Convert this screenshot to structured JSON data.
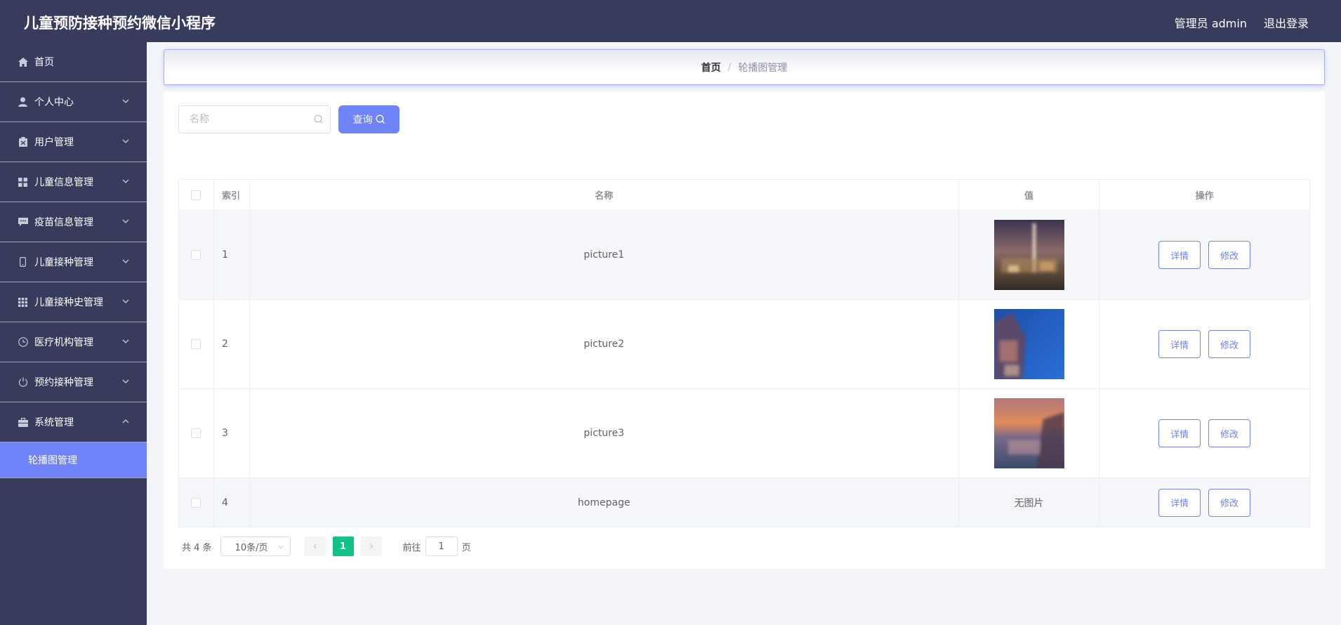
{
  "header": {
    "app_title": "儿童预防接种预约微信小程序",
    "admin_label": "管理员 admin",
    "logout_label": "退出登录"
  },
  "sidebar": {
    "items": [
      {
        "label": "首页",
        "icon": "home-icon"
      },
      {
        "label": "个人中心",
        "icon": "user-icon"
      },
      {
        "label": "用户管理",
        "icon": "clipboard-icon"
      },
      {
        "label": "儿童信息管理",
        "icon": "grid-icon"
      },
      {
        "label": "疫苗信息管理",
        "icon": "chat-icon"
      },
      {
        "label": "儿童接种管理",
        "icon": "phone-icon"
      },
      {
        "label": "儿童接种史管理",
        "icon": "apps-icon"
      },
      {
        "label": "医疗机构管理",
        "icon": "clock-icon"
      },
      {
        "label": "预约接种管理",
        "icon": "power-icon"
      },
      {
        "label": "系统管理",
        "icon": "briefcase-icon"
      }
    ],
    "submenu_active": "轮播图管理",
    "active_color": "#6e84f8"
  },
  "breadcrumb": {
    "home": "首页",
    "separator": "/",
    "current": "轮播图管理"
  },
  "search": {
    "placeholder": "名称",
    "value": "",
    "button_label": "查询"
  },
  "table": {
    "columns": [
      "索引",
      "名称",
      "值",
      "操作"
    ],
    "rows": [
      {
        "index": "1",
        "name": "picture1",
        "value_type": "image",
        "value_text": "",
        "detail": "详情",
        "edit": "修改"
      },
      {
        "index": "2",
        "name": "picture2",
        "value_type": "image",
        "value_text": "",
        "detail": "详情",
        "edit": "修改"
      },
      {
        "index": "3",
        "name": "picture3",
        "value_type": "image",
        "value_text": "",
        "detail": "详情",
        "edit": "修改"
      },
      {
        "index": "4",
        "name": "homepage",
        "value_type": "text",
        "value_text": "无图片",
        "detail": "详情",
        "edit": "修改"
      }
    ]
  },
  "pagination": {
    "total_label": "共 4 条",
    "page_size": "10条/页",
    "current_page": "1",
    "goto_label": "前往",
    "goto_value": "1",
    "page_suffix": "页"
  },
  "colors": {
    "header_bg": "#373b5c",
    "accent": "#6e84f8",
    "pager_active": "#13c28a"
  }
}
